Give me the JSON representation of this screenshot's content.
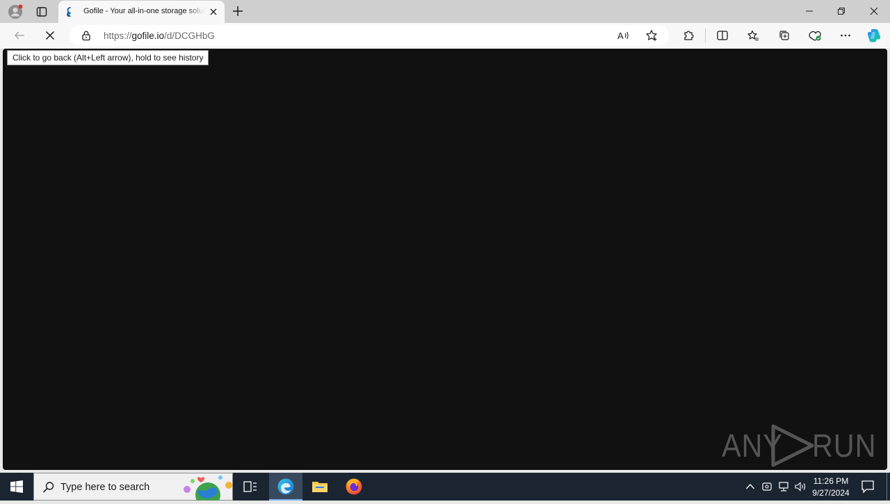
{
  "browser": {
    "tab": {
      "title": "Gofile - Your all-in-one storage solution",
      "favicon": "gofile-squirrel-icon"
    },
    "address_bar": {
      "url_prefix": "https://",
      "url_host": "gofile.io",
      "url_path": "/d/DCGHbG"
    },
    "tooltip": "Click to go back (Alt+Left arrow), hold to see history",
    "accent": "#0c59a4"
  },
  "page": {
    "background": "#111111"
  },
  "watermark": {
    "left": "ANY",
    "right": "RUN"
  },
  "taskbar": {
    "search_placeholder": "Type here to search",
    "clock": {
      "time": "11:26 PM",
      "date": "9/27/2024"
    },
    "apps": [
      "task-view",
      "microsoft-edge",
      "file-explorer",
      "firefox"
    ]
  }
}
